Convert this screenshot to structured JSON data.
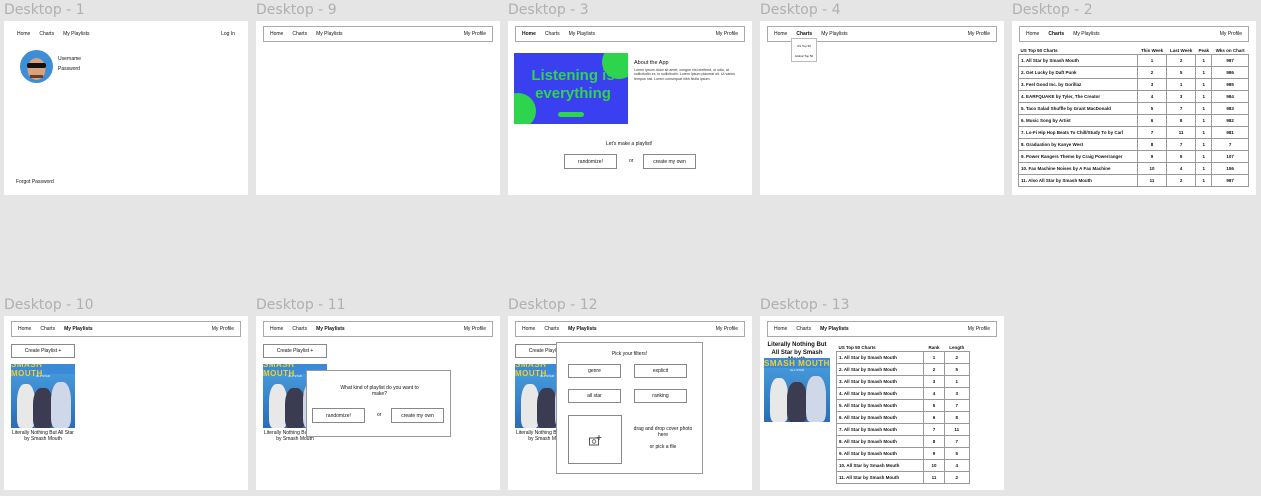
{
  "nav": {
    "home": "Home",
    "charts": "Charts",
    "playlists": "My Playlists",
    "profile": "My Profile",
    "login": "Log In"
  },
  "labels": {
    "d1": "Desktop - 1",
    "d9": "Desktop - 9",
    "d3": "Desktop - 3",
    "d4": "Desktop - 4",
    "d2": "Desktop - 2",
    "d10": "Desktop - 10",
    "d11": "Desktop - 11",
    "d12": "Desktop - 12",
    "d13": "Desktop - 13"
  },
  "login": {
    "username": "Username",
    "password": "Password",
    "forgot": "Forgot Password"
  },
  "home": {
    "hero_title": "Listening is everything",
    "about_title": "About the App",
    "about_body": "Lorem ipsum dolor sit amet, congue nisl eleifend, ut odio, at sollicitudin ex, in sollicitudin. Lorem ipsum placerat sit. Ut varius tempus nisl. Lorem consequat nibh Nulla ipsum.",
    "prompt": "Let's make a playlist!",
    "randomize": "randomize!",
    "or": "or",
    "create_own": "create my own"
  },
  "charts_menu": {
    "item1": "US Top 50",
    "item2": "Global Top 50"
  },
  "charts": {
    "title": "US Top 50 Charts",
    "headers": [
      "This Week",
      "Last Week",
      "Peak",
      "Wks on Chart"
    ],
    "rows": [
      {
        "song": "1. All Star by Smash Mouth",
        "tw": "1",
        "lw": "2",
        "peak": "1",
        "wks": "987"
      },
      {
        "song": "2. Get Lucky by Daft Punk",
        "tw": "2",
        "lw": "5",
        "peak": "1",
        "wks": "986"
      },
      {
        "song": "3. Feel Good Inc. by Gorillaz",
        "tw": "3",
        "lw": "1",
        "peak": "1",
        "wks": "985"
      },
      {
        "song": "4. EARFQUAKE by Tyler, The Creator",
        "tw": "4",
        "lw": "3",
        "peak": "1",
        "wks": "984"
      },
      {
        "song": "5. Taco Salad Shuffle by Grant MacDonald",
        "tw": "5",
        "lw": "7",
        "peak": "1",
        "wks": "983"
      },
      {
        "song": "6. Music Song by Artist",
        "tw": "6",
        "lw": "8",
        "peak": "1",
        "wks": "982"
      },
      {
        "song": "7. Lo-Fi Hip Hop Beats To Chill/Study To by Carl",
        "tw": "7",
        "lw": "11",
        "peak": "1",
        "wks": "981"
      },
      {
        "song": "8. Graduation by Kanye West",
        "tw": "8",
        "lw": "7",
        "peak": "1",
        "wks": "7"
      },
      {
        "song": "9. Power Rangers Theme by Craig Powerranger",
        "tw": "9",
        "lw": "5",
        "peak": "1",
        "wks": "107"
      },
      {
        "song": "10. Fax Machine Noises by A Fax Machine",
        "tw": "10",
        "lw": "4",
        "peak": "1",
        "wks": "156"
      },
      {
        "song": "11. Also All Star by Smash Mouth",
        "tw": "11",
        "lw": "2",
        "peak": "1",
        "wks": "987"
      }
    ]
  },
  "playlists": {
    "create": "Create Playlist  +",
    "cover_band": "SMASH MOUTH",
    "cover_sub": "ALL STAR",
    "caption": "Literally Nothing But All Star by Smash Mouth",
    "dialog_q": "What kind of playlist do you want to make?",
    "filters_title": "Pick your filters!",
    "filters": [
      "genre",
      "explicit",
      "all star",
      "ranking"
    ],
    "drop": "drag and drop cover photo here",
    "pick": "or pick a file"
  },
  "playlist_detail": {
    "title": "Literally Nothing But All Star by Smash Mouth",
    "table_title": "US Top 50 Charts",
    "headers": [
      "Rank",
      "Length"
    ],
    "rows": [
      {
        "song": "1. All Star by Smash Mouth",
        "rank": "1",
        "len": "2"
      },
      {
        "song": "2. All Star by Smash Mouth",
        "rank": "2",
        "len": "5"
      },
      {
        "song": "3. All Star by Smash Mouth",
        "rank": "3",
        "len": "1"
      },
      {
        "song": "4. All Star by Smash Mouth",
        "rank": "4",
        "len": "3"
      },
      {
        "song": "5. All Star by Smash Mouth",
        "rank": "5",
        "len": "7"
      },
      {
        "song": "6. All Star by Smash Mouth",
        "rank": "6",
        "len": "8"
      },
      {
        "song": "7. All Star by Smash Mouth",
        "rank": "7",
        "len": "11"
      },
      {
        "song": "8. All Star by Smash Mouth",
        "rank": "8",
        "len": "7"
      },
      {
        "song": "9. All Star by Smash Mouth",
        "rank": "9",
        "len": "5"
      },
      {
        "song": "10. All Star by Smash Mouth",
        "rank": "10",
        "len": "4"
      },
      {
        "song": "11. All Star by Smash Mouth",
        "rank": "11",
        "len": "2"
      }
    ]
  },
  "colors": {
    "hero_bg": "#3a3ff0",
    "hero_text": "#2fd44e",
    "label": "#b0b0b0"
  }
}
